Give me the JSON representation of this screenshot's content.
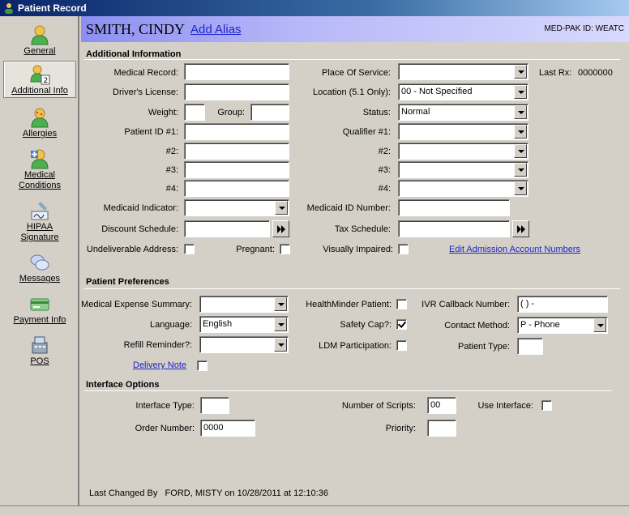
{
  "window": {
    "title": "Patient Record"
  },
  "sidebar": {
    "items": [
      {
        "label": "General",
        "icon": "person-icon"
      },
      {
        "label": "Additional Info",
        "icon": "person-info-icon"
      },
      {
        "label": "Allergies",
        "icon": "allergies-icon"
      },
      {
        "label": "Medical Conditions",
        "icon": "medical-conditions-icon"
      },
      {
        "label": "HIPAA Signature",
        "icon": "signature-icon"
      },
      {
        "label": "Messages",
        "icon": "messages-icon"
      },
      {
        "label": "Payment Info",
        "icon": "payment-icon"
      },
      {
        "label": "POS",
        "icon": "pos-icon"
      }
    ],
    "active": "Additional Info"
  },
  "header": {
    "patient_name": "SMITH, CINDY",
    "add_alias": "Add Alias",
    "med_pak_id": "MED-PAK ID: WEATC"
  },
  "additional": {
    "section_title": "Additional Information",
    "medical_record": {
      "label": "Medical Record:",
      "value": ""
    },
    "drivers_license": {
      "label": "Driver's License:",
      "value": ""
    },
    "weight": {
      "label": "Weight:",
      "value": ""
    },
    "group": {
      "label": "Group:",
      "value": ""
    },
    "patient_id_1": {
      "label": "Patient ID #1:",
      "value": ""
    },
    "id_2": {
      "label": "#2:",
      "value": ""
    },
    "id_3": {
      "label": "#3:",
      "value": ""
    },
    "id_4": {
      "label": "#4:",
      "value": ""
    },
    "medicaid_indicator": {
      "label": "Medicaid Indicator:",
      "value": ""
    },
    "discount_schedule": {
      "label": "Discount Schedule:",
      "value": ""
    },
    "undeliverable_address": {
      "label": "Undeliverable Address:",
      "checked": false
    },
    "pregnant": {
      "label": "Pregnant:",
      "checked": false
    },
    "place_of_service": {
      "label": "Place Of Service:",
      "value": ""
    },
    "last_rx": {
      "label": "Last Rx:",
      "value": "0000000"
    },
    "location": {
      "label": "Location (5.1 Only):",
      "value": "00 - Not Specified"
    },
    "status": {
      "label": "Status:",
      "value": "Normal"
    },
    "qualifier_1": {
      "label": "Qualifier #1:",
      "value": ""
    },
    "qualifier_2": {
      "label": "#2:",
      "value": ""
    },
    "qualifier_3": {
      "label": "#3:",
      "value": ""
    },
    "qualifier_4": {
      "label": "#4:",
      "value": ""
    },
    "medicaid_id_number": {
      "label": "Medicaid ID Number:",
      "value": ""
    },
    "tax_schedule": {
      "label": "Tax Schedule:",
      "value": ""
    },
    "visually_impaired": {
      "label": "Visually Impaired:",
      "checked": false
    },
    "edit_admission_link": "Edit Admission Account Numbers"
  },
  "preferences": {
    "section_title": "Patient Preferences",
    "medical_expense_summary": {
      "label": "Medical Expense Summary:",
      "value": ""
    },
    "language": {
      "label": "Language:",
      "value": "English"
    },
    "refill_reminder": {
      "label": "Refill Reminder?:",
      "value": ""
    },
    "delivery_note_link": "Delivery Note",
    "delivery_note_checked": false,
    "healthminder_patient": {
      "label": "HealthMinder Patient:",
      "checked": false
    },
    "safety_cap": {
      "label": "Safety Cap?:",
      "checked": true
    },
    "ldm_participation": {
      "label": "LDM Participation:",
      "checked": false
    },
    "ivr_callback_number": {
      "label": "IVR Callback Number:",
      "value": "(   )    -"
    },
    "contact_method": {
      "label": "Contact Method:",
      "value": "P - Phone"
    },
    "patient_type": {
      "label": "Patient Type:",
      "value": ""
    }
  },
  "interface": {
    "section_title": "Interface Options",
    "interface_type": {
      "label": "Interface Type:",
      "value": ""
    },
    "order_number": {
      "label": "Order Number:",
      "value": "0000"
    },
    "number_of_scripts": {
      "label": "Number of Scripts:",
      "value": "00"
    },
    "priority": {
      "label": "Priority:",
      "value": ""
    },
    "use_interface": {
      "label": "Use Interface:",
      "checked": false
    }
  },
  "footer": {
    "last_changed": "Last Changed By   FORD, MISTY on 10/28/2011 at 12:10:36"
  }
}
